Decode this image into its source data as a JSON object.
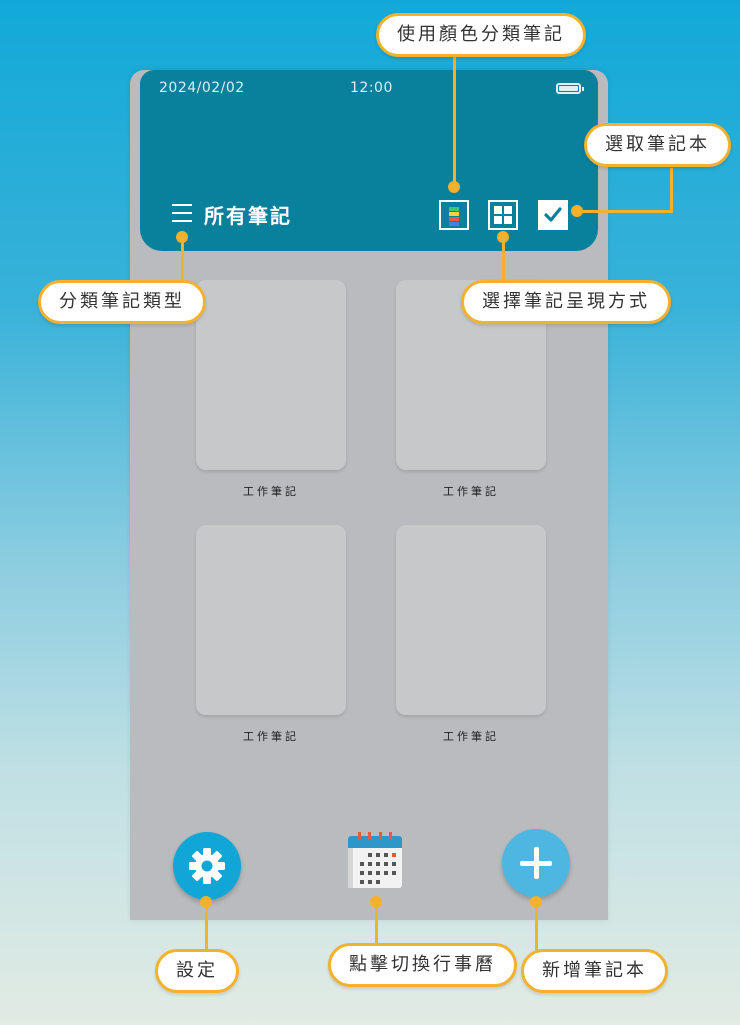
{
  "status_bar": {
    "date": "2024/02/02",
    "time": "12:00"
  },
  "header": {
    "title": "所有筆記"
  },
  "notebooks": [
    {
      "label": "工作筆記"
    },
    {
      "label": "工作筆記"
    },
    {
      "label": "工作筆記"
    },
    {
      "label": "工作筆記"
    }
  ],
  "icons": {
    "menu": "menu-icon",
    "color_category": "color-category-icon",
    "grid_view": "grid-view-icon",
    "select": "checkbox-icon",
    "settings": "gear-icon",
    "calendar": "calendar-icon",
    "add": "plus-icon"
  },
  "callouts": {
    "color_classify": "使用顏色分類筆記",
    "select_notebook": "選取筆記本",
    "category_type": "分類筆記類型",
    "display_mode": "選擇筆記呈現方式",
    "settings": "設定",
    "calendar_toggle": "點擊切換行事曆",
    "add_notebook": "新增筆記本"
  },
  "colors": {
    "header": "#0a819c",
    "body": "#b9bbbe",
    "card": "#c7c8ca",
    "settings_button": "#11a6d5",
    "add_button": "#4db7e1",
    "callout_accent": "#f4b12d"
  }
}
